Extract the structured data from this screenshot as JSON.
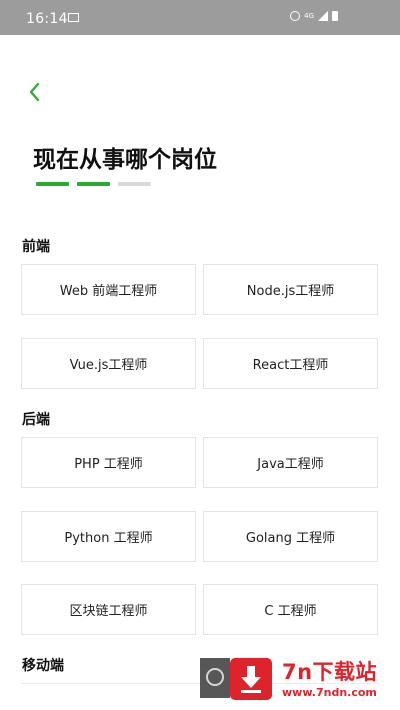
{
  "status_bar": {
    "time": "16:14",
    "network": "4G"
  },
  "page": {
    "title": "现在从事哪个岗位",
    "progress": {
      "step": 2,
      "total": 3
    }
  },
  "sections": {
    "frontend": {
      "title": "前端",
      "options": [
        "Web 前端工程师",
        "Node.js工程师",
        "Vue.js工程师",
        "React工程师"
      ]
    },
    "backend": {
      "title": "后端",
      "options": [
        "PHP 工程师",
        "Java工程师",
        "Python 工程师",
        "Golang 工程师",
        "区块链工程师",
        "C 工程师"
      ]
    },
    "mobile": {
      "title": "移动端"
    }
  },
  "watermark": {
    "title": "7n下载站",
    "url": "www.7ndn.com"
  },
  "colors": {
    "accent": "#2caa30",
    "statusbar": "#9c9c9c",
    "watermark": "#e0232b"
  }
}
